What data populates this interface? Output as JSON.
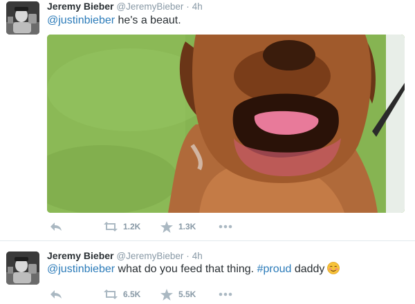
{
  "tweets": [
    {
      "fullname": "Jeremy Bieber",
      "username": "@JeremyBieber",
      "dot": "·",
      "time": "4h",
      "mention": "@justinbieber",
      "body": " he's a beaut.",
      "retweets": "1.2K",
      "favorites": "1.3K"
    },
    {
      "fullname": "Jeremy Bieber",
      "username": "@JeremyBieber",
      "dot": "·",
      "time": "4h",
      "mention": "@justinbieber",
      "body_before": " what do you feed that thing. ",
      "hashtag": "#proud",
      "body_after": " daddy",
      "retweets": "6.5K",
      "favorites": "5.5K"
    }
  ],
  "colors": {
    "link": "#2b7bb9",
    "muted": "#8899a6",
    "icon": "#aab8c2"
  },
  "icons": [
    "reply-icon",
    "retweet-icon",
    "favorite-star-icon",
    "more-dots-icon",
    "blushing-smile-emoji"
  ]
}
